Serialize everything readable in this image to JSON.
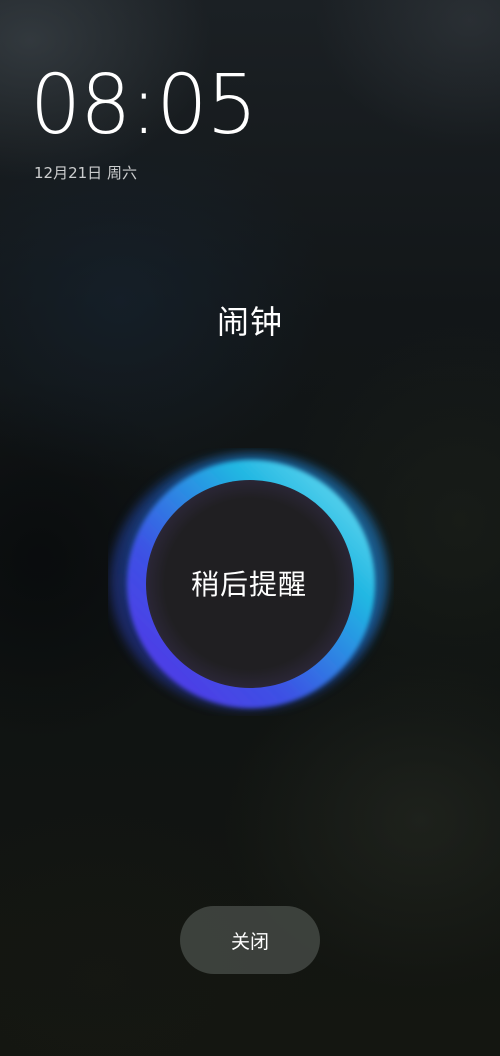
{
  "lockscreen": {
    "time": "08:05",
    "date": "12月21日 周六"
  },
  "alarm": {
    "title": "闹钟",
    "snooze_label": "稍后提醒",
    "close_label": "关闭"
  },
  "colors": {
    "ring_cyan": "#2ec7e6",
    "ring_violet": "#6a3cf0",
    "ring_blue": "#2a55d8",
    "close_button_bg": "#474a46"
  }
}
